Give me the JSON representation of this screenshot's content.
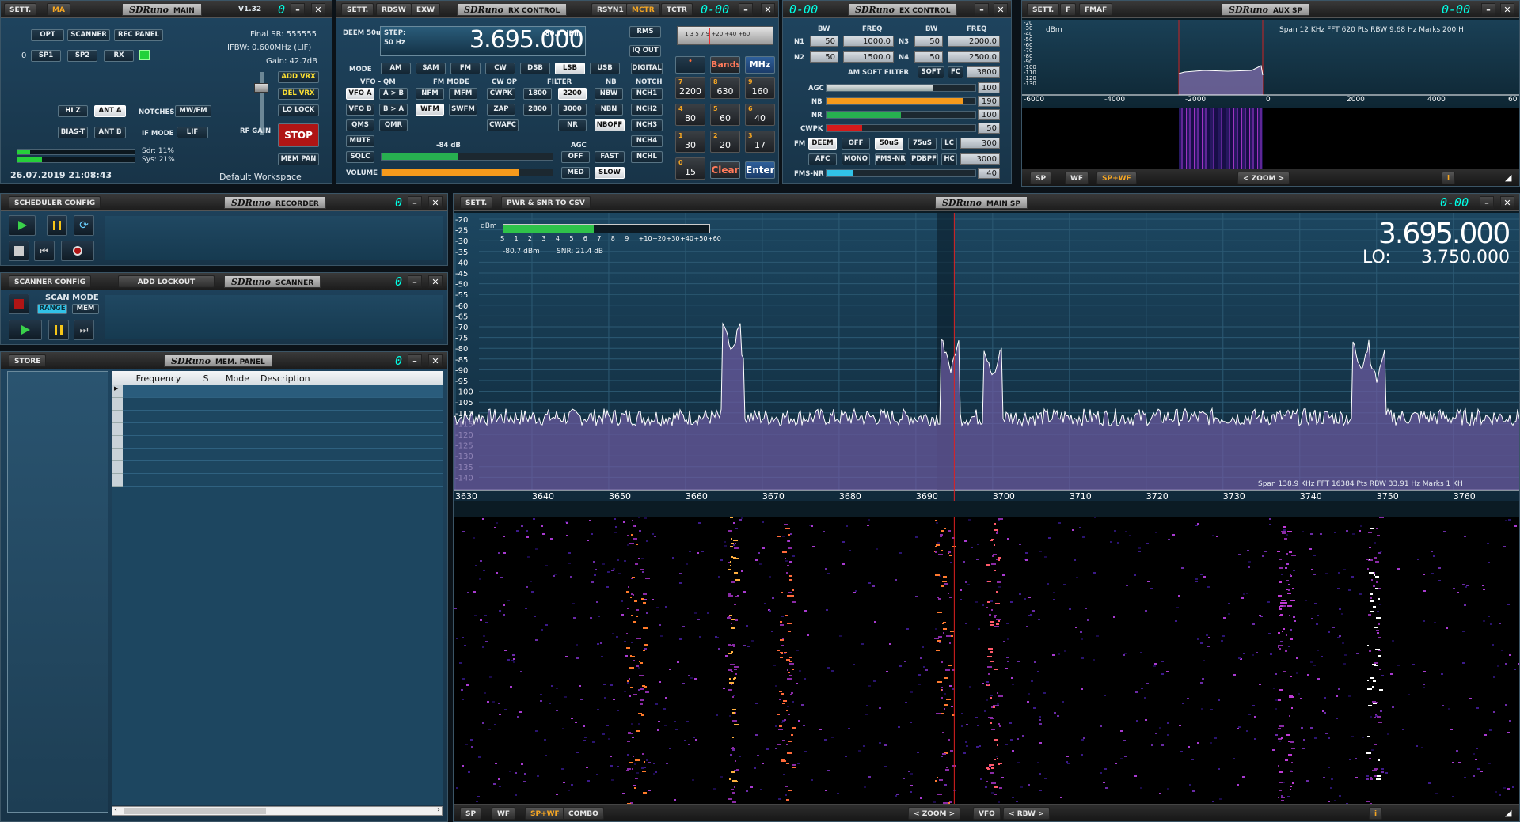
{
  "main": {
    "sett": "SETT.",
    "ma": "MA",
    "logo": "SDRuno",
    "title": "MAIN",
    "version": "V1.32",
    "seg": "0",
    "btns": [
      "OPT",
      "SCANNER",
      "REC PANEL",
      "SP1",
      "SP2",
      "RX",
      "HI Z",
      "ANT A",
      "BIAS-T",
      "ANT B"
    ],
    "rx_index": "0",
    "notches": "NOTCHES",
    "mwfm": "MW/FM",
    "ifmode": "IF MODE",
    "lif": "LIF",
    "final_sr": "Final SR: 555555",
    "ifbw": "IFBW: 0.600MHz (LIF)",
    "gain": "Gain: 42.7dB",
    "add_vrx": "ADD VRX",
    "del_vrx": "DEL VRX",
    "lo_lock": "LO LOCK",
    "stop": "STOP",
    "rf_gain": "RF GAIN",
    "mem_pan": "MEM PAN",
    "sdr": "Sdr: 11%",
    "sys": "Sys: 21%",
    "sdr_load": 0.11,
    "sys_load": 0.21,
    "datetime": "26.07.2019 21:08:43",
    "workspace": "Default Workspace"
  },
  "rx": {
    "sett": "SETT.",
    "rdsw": "RDSW",
    "exw": "EXW",
    "logo": "SDRuno",
    "title": "RX CONTROL",
    "rsyn": "RSYN1",
    "mctr": "MCTR",
    "tctr": "TCTR",
    "seg": "0-00",
    "deem": "DEEM 50u",
    "step_l": "STEP:",
    "step_v": "50 Hz",
    "freq": "3.695.000",
    "dbm": "-80.7 dBm",
    "rms": "RMS",
    "iqout": "IQ OUT",
    "mode_l": "MODE",
    "modes": [
      "AM",
      "SAM",
      "FM",
      "CW",
      "DSB",
      "LSB",
      "USB",
      "DIGITAL"
    ],
    "vfo_l": "VFO - QM",
    "fmmode_l": "FM MODE",
    "cwop_l": "CW OP",
    "filter_l": "FILTER",
    "nb_l": "NB",
    "notch_l": "NOTCH",
    "row1": [
      "VFO A",
      "A > B",
      "NFM",
      "MFM",
      "CWPK",
      "1800",
      "2200",
      "NBW",
      "NCH1"
    ],
    "row2": [
      "VFO B",
      "B > A",
      "WFM",
      "SWFM",
      "ZAP",
      "2800",
      "3000",
      "NBN",
      "NCH2"
    ],
    "row3": [
      "QMS",
      "QMR",
      "CWAFC",
      "NR",
      "NBOFF",
      "NCH3"
    ],
    "mute": "MUTE",
    "nch4": "NCH4",
    "sqlc": "SQLC",
    "sq_db": "-84 dB",
    "agc_l": "AGC",
    "off": "OFF",
    "fast": "FAST",
    "nchl": "NCHL",
    "volume": "VOLUME",
    "med": "MED",
    "slow": "SLOW",
    "volume_level": 0.8,
    "sqlc_level": 0.45,
    "bands": "Bands",
    "mhz": "MHz",
    "clear": "Clear",
    "enter": "Enter",
    "meter_scale": "1 3 5 7 9 +20 +40 +60",
    "pads": [
      {
        "k": "7",
        "v": "2200"
      },
      {
        "k": "8",
        "v": "630"
      },
      {
        "k": "9",
        "v": "160"
      },
      {
        "k": "4",
        "v": "80"
      },
      {
        "k": "5",
        "v": "60"
      },
      {
        "k": "6",
        "v": "40"
      },
      {
        "k": "1",
        "v": "30"
      },
      {
        "k": "2",
        "v": "20"
      },
      {
        "k": "3",
        "v": "17"
      },
      {
        "k": "0",
        "v": "15"
      }
    ]
  },
  "ex": {
    "logo": "SDRuno",
    "title": "EX CONTROL",
    "seg": "0-00",
    "bw": "BW",
    "freq": "FREQ",
    "n1": "N1",
    "n1bw": "50",
    "n1f": "1000.0",
    "n2": "N2",
    "n2bw": "50",
    "n2f": "1500.0",
    "n3": "N3",
    "n3bw": "50",
    "n3f": "2000.0",
    "n4": "N4",
    "n4bw": "50",
    "n4f": "2500.0",
    "amsoft": "AM SOFT FILTER",
    "soft": "SOFT",
    "fc": "FC",
    "fcv": "3800",
    "agc": "AGC",
    "agcv": "100",
    "agc_level": 0.72,
    "nb": "NB",
    "nbv": "190",
    "nb_level": 0.92,
    "nr": "NR",
    "nrv": "100",
    "nr_level": 0.5,
    "cwpk": "CWPK",
    "cwpkv": "50",
    "cwpk_level": 0.24,
    "fm": "FM",
    "deem": "DEEM",
    "off": "OFF",
    "us50": "50uS",
    "us75": "75uS",
    "lc": "LC",
    "lcv": "300",
    "afc": "AFC",
    "mono": "MONO",
    "fmsnr_btn": "FMS-NR",
    "pdbpf": "PDBPF",
    "hc": "HC",
    "hcv": "3000",
    "fmsnr": "FMS-NR",
    "fmsnrv": "40",
    "fmsnr_level": 0.18
  },
  "aux": {
    "sett": "SETT.",
    "f": "F",
    "fmaf": "FMAF",
    "logo": "SDRuno",
    "title": "AUX SP",
    "seg": "0-00",
    "dbm": "dBm",
    "info": "Span 12 KHz   FFT 620 Pts   RBW 9.68 Hz   Marks 200 H",
    "yticks": [
      "-20",
      "-30",
      "-40",
      "-50",
      "-60",
      "-70",
      "-80",
      "-90",
      "-100",
      "-110",
      "-120",
      "-130"
    ],
    "xticks": [
      "-6000",
      "-4000",
      "-2000",
      "0",
      "2000",
      "4000",
      "60"
    ],
    "sp": "SP",
    "wf": "WF",
    "spwf": "SP+WF",
    "zoom": "ZOOM",
    "i": "i"
  },
  "sched": {
    "title": "SCHEDULER CONFIG",
    "logo": "SDRuno",
    "name": "RECORDER",
    "seg": "0"
  },
  "scan": {
    "title": "SCANNER CONFIG",
    "lockout": "ADD LOCKOUT",
    "logo": "SDRuno",
    "name": "SCANNER",
    "seg": "0",
    "scan_mode": "SCAN MODE",
    "range": "RANGE",
    "mem": "MEM"
  },
  "mem": {
    "store": "STORE",
    "logo": "SDRuno",
    "name": "MEM. PANEL",
    "seg": "0",
    "cols": [
      "Frequency",
      "S",
      "Mode",
      "Description"
    ]
  },
  "mainsp": {
    "sett": "SETT.",
    "csv": "PWR & SNR TO CSV",
    "logo": "SDRuno",
    "title": "MAIN SP",
    "seg": "0-00",
    "dbm": "dBm",
    "meter_scale": [
      "S",
      "1",
      "2",
      "3",
      "4",
      "5",
      "6",
      "7",
      "8",
      "9",
      "+10",
      "+20",
      "+30",
      "+40",
      "+50",
      "+60"
    ],
    "level": "-80.7 dBm",
    "snr": "SNR: 21.4 dB",
    "s_level": 0.44,
    "freq": "3.695.000",
    "lo_l": "LO:",
    "lo": "3.750.000",
    "yticks": [
      "-20",
      "-25",
      "-30",
      "-35",
      "-40",
      "-45",
      "-50",
      "-55",
      "-60",
      "-65",
      "-70",
      "-75",
      "-80",
      "-85",
      "-90",
      "-95",
      "-100",
      "-105",
      "-110",
      "-115",
      "-120",
      "-125",
      "-130",
      "-135",
      "-140"
    ],
    "xticks": [
      "3630",
      "3640",
      "3650",
      "3660",
      "3670",
      "3680",
      "3690",
      "3700",
      "3710",
      "3720",
      "3730",
      "3740",
      "3750",
      "3760"
    ],
    "info": "Span 138.9 KHz   FFT 16384 Pts   RBW 33.91 Hz   Marks 1 KH",
    "sp": "SP",
    "wf": "WF",
    "spwf": "SP+WF",
    "combo": "COMBO",
    "zoom": "ZOOM",
    "vfo": "VFO",
    "rbw": "RBW",
    "i": "i"
  },
  "colors": {
    "accent": "#31c3e8",
    "orange": "#f5a623",
    "segment": "#00ffe6",
    "stop": "#b01515"
  }
}
